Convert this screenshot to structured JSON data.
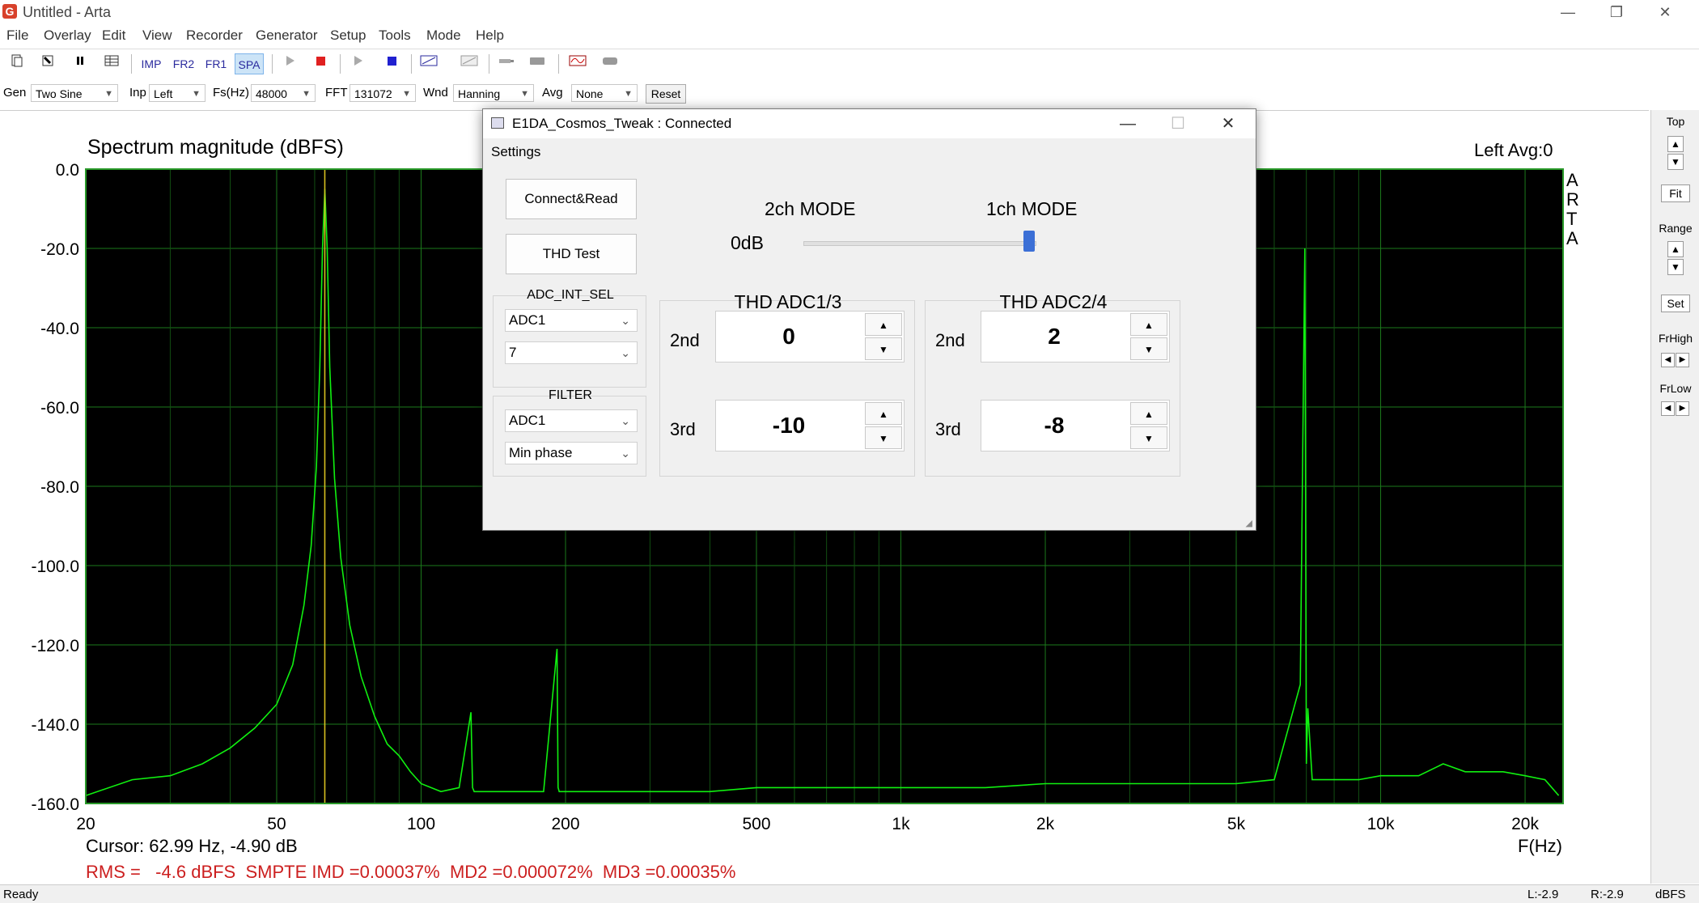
{
  "window": {
    "title": "Untitled - Arta",
    "app_icon": "arta-app-icon",
    "controls": [
      "—",
      "❐",
      "✕"
    ]
  },
  "menu": [
    "File",
    "Overlay",
    "Edit",
    "View",
    "Recorder",
    "Generator",
    "Setup",
    "Tools",
    "Mode",
    "Help"
  ],
  "toolbar_buttons": {
    "imp": "IMP",
    "fr2": "FR2",
    "fr1": "FR1",
    "spa": "SPA"
  },
  "toolbar2": {
    "gen_label": "Gen",
    "gen_value": "Two Sine",
    "inp_label": "Inp",
    "inp_value": "Left",
    "fs_label": "Fs(Hz)",
    "fs_value": "48000",
    "fft_label": "FFT",
    "fft_value": "131072",
    "wnd_label": "Wnd",
    "wnd_value": "Hanning",
    "avg_label": "Avg",
    "avg_value": "None",
    "reset_label": "Reset"
  },
  "chart": {
    "title": "Spectrum magnitude (dBFS)",
    "channel_info": "Left   Avg:0",
    "side_label": [
      "A",
      "R",
      "T",
      "A"
    ],
    "xlabel": "F(Hz)",
    "cursor_text": "Cursor: 62.99 Hz, -4.90 dB",
    "measure_text": "RMS =   -4.6 dBFS  SMPTE IMD =0.00037%  MD2 =0.000072%  MD3 =0.00035%",
    "accent_color": "#cc1f1f",
    "trace_color": "#10f010",
    "grid_color": "#1c7a1c"
  },
  "chart_data": {
    "type": "line",
    "title": "Spectrum magnitude (dBFS)",
    "xlabel": "F(Hz)",
    "ylabel": "",
    "xscale": "log",
    "xlim": [
      20,
      24000
    ],
    "ylim": [
      -160,
      0
    ],
    "x_ticks": [
      20,
      50,
      100,
      200,
      500,
      1000,
      2000,
      5000,
      10000,
      20000
    ],
    "x_tick_labels": [
      "20",
      "50",
      "100",
      "200",
      "500",
      "1k",
      "2k",
      "5k",
      "10k",
      "20k"
    ],
    "y_ticks": [
      0,
      -20,
      -40,
      -60,
      -80,
      -100,
      -120,
      -140,
      -160
    ],
    "y_tick_labels": [
      "0.0",
      "-20.0",
      "-40.0",
      "-60.0",
      "-80.0",
      "-100.0",
      "-120.0",
      "-140.0",
      "-160.0"
    ],
    "grid": true,
    "cursor_hz": 62.99,
    "series": [
      {
        "x": [
          20,
          25,
          30,
          35,
          40,
          45,
          50,
          54,
          57,
          59,
          60.5,
          61.5,
          62.3,
          63,
          63.7,
          64.5,
          66,
          68,
          71,
          75,
          80,
          85,
          90,
          95,
          100,
          110,
          120,
          127,
          128,
          129,
          140,
          160,
          180,
          192,
          193,
          194,
          210,
          250,
          300,
          400,
          500,
          700,
          1000,
          1500,
          2000,
          3000,
          4000,
          5000,
          6000,
          6800,
          6950,
          7000,
          7050,
          7200,
          8000,
          9000,
          10000,
          12000,
          13500,
          15000,
          18000,
          20000,
          22000,
          23500
        ],
        "y": [
          -158,
          -154,
          -153,
          -150,
          -146,
          -141,
          -135,
          -125,
          -110,
          -95,
          -75,
          -50,
          -20,
          -5,
          -20,
          -50,
          -78,
          -98,
          -115,
          -128,
          -138,
          -145,
          -148,
          -152,
          -155,
          -157,
          -156,
          -137,
          -156,
          -157,
          -157,
          -157,
          -157,
          -121,
          -156,
          -157,
          -157,
          -157,
          -157,
          -157,
          -156,
          -156,
          -156,
          -156,
          -155,
          -155,
          -155,
          -155,
          -154,
          -130,
          -20,
          -150,
          -136,
          -154,
          -154,
          -154,
          -153,
          -153,
          -150,
          -152,
          -152,
          -153,
          -154,
          -158
        ]
      }
    ]
  },
  "right_panel": {
    "top_label": "Top",
    "fit_label": "Fit",
    "range_label": "Range",
    "set_label": "Set",
    "frhigh_label": "FrHigh",
    "frlow_label": "FrLow"
  },
  "status": {
    "left": "Ready",
    "l_val": "L:-2.9",
    "r_val": "R:-2.9",
    "unit": "dBFS"
  },
  "dialog": {
    "title": "E1DA_Cosmos_Tweak : Connected",
    "menu": "Settings",
    "connect_label": "Connect&Read",
    "thd_test_label": "THD Test",
    "adc_int_sel_title": "ADC_INT_SEL",
    "adc_int_sel_value": "ADC1",
    "adc_int_sel_num": "7",
    "filter_title": "FILTER",
    "filter_adc": "ADC1",
    "filter_phase": "Min phase",
    "mode_2ch": "2ch MODE",
    "mode_1ch": "1ch MODE",
    "gain_label": "0dB",
    "mode_slider_fraction": 1.0,
    "thd13_title": "THD ADC1/3",
    "thd24_title": "THD ADC2/4",
    "second_label": "2nd",
    "third_label": "3rd",
    "thd13_2nd": "0",
    "thd13_3rd": "-10",
    "thd24_2nd": "2",
    "thd24_3rd": "-8"
  }
}
